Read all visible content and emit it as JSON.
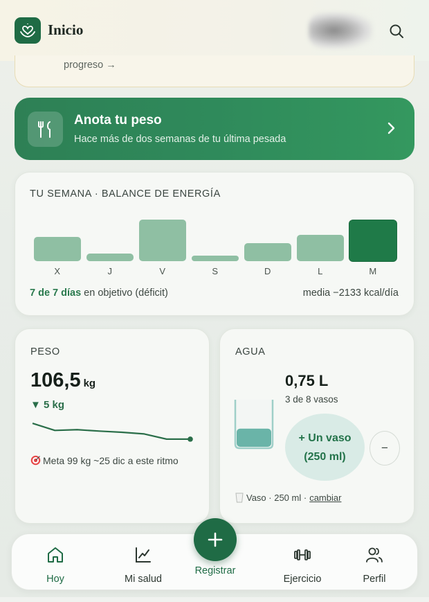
{
  "header": {
    "title": "Inicio",
    "logo_icon": "heart-hands-icon",
    "search_icon": "search-icon"
  },
  "prev_card": {
    "link": "progreso →"
  },
  "banner": {
    "title": "Anota tu peso",
    "subtitle": "Hace más de dos semanas de tu última pesada",
    "icon": "fork-knife-icon"
  },
  "week": {
    "label": "TU SEMANA · BALANCE DE ENERGÍA",
    "days": [
      {
        "label": "X",
        "value": 0.42,
        "today": false
      },
      {
        "label": "J",
        "value": 0.13,
        "today": false
      },
      {
        "label": "V",
        "value": 0.72,
        "today": false
      },
      {
        "label": "S",
        "value": 0.1,
        "today": false
      },
      {
        "label": "D",
        "value": 0.31,
        "today": false
      },
      {
        "label": "L",
        "value": 0.46,
        "today": false
      },
      {
        "label": "M",
        "value": 0.71,
        "today": true
      }
    ],
    "goal_days": "7 de 7 días",
    "goal_text": " en objetivo (déficit)",
    "average": "media −2133 kcal/día",
    "bar_color": "#8fbfa3",
    "today_color": "#1f7a48"
  },
  "weight": {
    "label": "PESO",
    "value": "106,5",
    "unit": "kg",
    "delta": "▼ 5 kg",
    "goal": "Meta 99 kg ~25 dic a este ritmo",
    "goal_icon": "target-icon",
    "trend": [
      0.85,
      0.55,
      0.58,
      0.52,
      0.47,
      0.4,
      0.18,
      0.18
    ]
  },
  "water": {
    "label": "AGUA",
    "value": "0,75 L",
    "count": "3 de 8 vasos",
    "fill": 0.375,
    "add_button": "+ Un vaso (250 ml)",
    "minus_button": "−",
    "footer_text": "Vaso · 250 ml · ",
    "footer_link": "cambiar",
    "glass_icon": "glass-icon"
  },
  "nav": {
    "items": [
      {
        "label": "Hoy",
        "icon": "home-icon"
      },
      {
        "label": "Mi salud",
        "icon": "chart-line-icon"
      },
      {
        "label": "Registrar",
        "icon": "plus-icon"
      },
      {
        "label": "Ejercicio",
        "icon": "dumbbell-icon"
      },
      {
        "label": "Perfil",
        "icon": "users-icon"
      }
    ]
  }
}
